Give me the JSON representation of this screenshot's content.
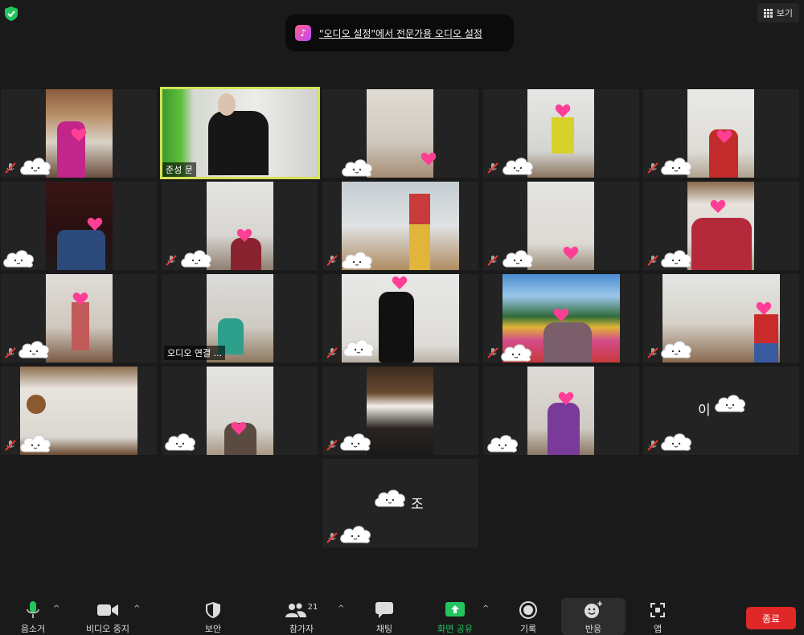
{
  "security_badge": "shield-icon",
  "view_button": {
    "label": "보기"
  },
  "banner": {
    "text": "\"오디오 설정\"에서 전문가용 오디오 설정"
  },
  "participants": [
    {
      "id": "p1",
      "name": ""
    },
    {
      "id": "p2",
      "name": "준성 문",
      "active": true
    },
    {
      "id": "p3",
      "name": ""
    },
    {
      "id": "p4",
      "name": ""
    },
    {
      "id": "p5",
      "name": ""
    },
    {
      "id": "p6",
      "name": ""
    },
    {
      "id": "p7",
      "name": ""
    },
    {
      "id": "p8",
      "name": ""
    },
    {
      "id": "p9",
      "name": ""
    },
    {
      "id": "p10",
      "name": ""
    },
    {
      "id": "p11",
      "name": ""
    },
    {
      "id": "p12",
      "name": "오디오 연결 ..."
    },
    {
      "id": "p13",
      "name": ""
    },
    {
      "id": "p14",
      "name": ""
    },
    {
      "id": "p15",
      "name": ""
    },
    {
      "id": "p16",
      "name": ""
    },
    {
      "id": "p17",
      "name": ""
    },
    {
      "id": "p18",
      "name": ""
    },
    {
      "id": "p19",
      "name": ""
    },
    {
      "id": "p20",
      "name": "이",
      "video_off": true
    },
    {
      "id": "p21",
      "name": "조",
      "video_off": true
    }
  ],
  "toolbar": {
    "mute": "음소거",
    "stop_video": "비디오 중지",
    "security": "보안",
    "participants": "참가자",
    "participants_count": "21",
    "chat": "채팅",
    "share_screen": "화면 공유",
    "record": "기록",
    "reactions": "반응",
    "apps": "앱",
    "end": "종료"
  },
  "colors": {
    "active_speaker": "#d4e157",
    "share_green": "#22c55e",
    "end_red": "#e02828",
    "mute_red": "#e53935"
  }
}
